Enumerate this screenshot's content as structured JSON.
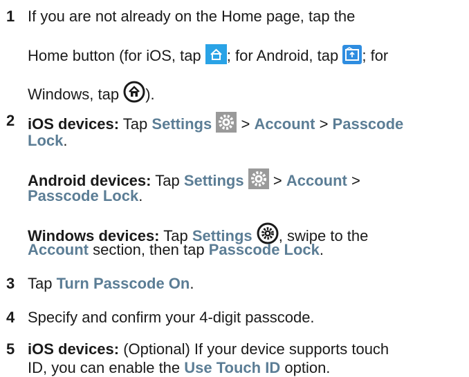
{
  "steps": [
    {
      "number": "1",
      "text_a": "If you are not already on the Home page, tap the",
      "text_b": "Home button (for iOS, tap",
      "text_c": "; for Android, tap",
      "text_d": "; for",
      "text_e": "Windows, tap",
      "text_f": ").",
      "icons": [
        "home-ios-icon",
        "home-android-icon",
        "home-windows-icon"
      ]
    },
    {
      "number": "2",
      "ios": {
        "lead": "iOS devices:",
        "tap": "Tap",
        "settings": "Settings",
        "sep1": ">",
        "account": "Account",
        "sep2": ">",
        "passcode_a": "Passcode",
        "passcode_b": "Lock",
        "end": "."
      },
      "android": {
        "lead": "Android devices:",
        "tap": "Tap",
        "settings": "Settings",
        "sep1": ">",
        "account": "Account",
        "sep2": ">",
        "passcode": "Passcode Lock",
        "end": "."
      },
      "windows": {
        "lead": "Windows devices:",
        "tap": "Tap",
        "settings": "Settings",
        "mid": ", swipe to the",
        "account": "Account",
        "mid2": "section, then tap",
        "passcode": "Passcode Lock",
        "end": "."
      },
      "icons": [
        "settings-gear-icon",
        "settings-gear-icon",
        "settings-circle-icon"
      ]
    },
    {
      "number": "3",
      "tap": "Tap",
      "turn_on": "Turn Passcode On",
      "end": "."
    },
    {
      "number": "4",
      "text": "Specify and confirm your 4-digit passcode."
    },
    {
      "number": "5",
      "lead": "iOS devices:",
      "text_a": "(Optional) If your device supports touch",
      "text_b": "ID, you can enable the",
      "touch_id": "Use Touch ID",
      "text_c": "option."
    }
  ],
  "colors": {
    "ui_text": "#5b7d95",
    "ios_blue": "#2aa3e6",
    "android_blue": "#2f8de0",
    "gear_gray": "#9a9a9a"
  }
}
